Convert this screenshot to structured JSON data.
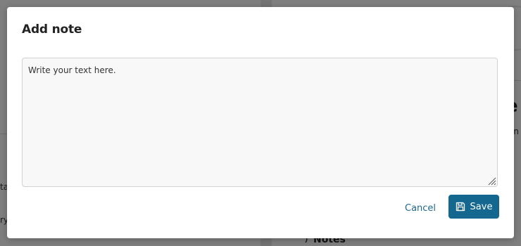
{
  "background": {
    "notes_heading": "Notes",
    "right_fragment_big": "e",
    "right_fragment_small": "en",
    "left_fragment_1": "ta",
    "left_fragment_2": "ry"
  },
  "dialog": {
    "title": "Add note",
    "textarea": {
      "value": "",
      "placeholder": "Write your text here."
    },
    "cancel_label": "Cancel",
    "save_label": "Save"
  },
  "colors": {
    "accent": "#14688f",
    "link": "#1b6a8e",
    "overlay": "rgba(0,0,0,0.5)",
    "textarea_bg": "#f8f8f8"
  },
  "icons": {
    "save": "floppy-disk-icon",
    "resize": "resize-grip-icon",
    "notes": "notes-icon"
  }
}
